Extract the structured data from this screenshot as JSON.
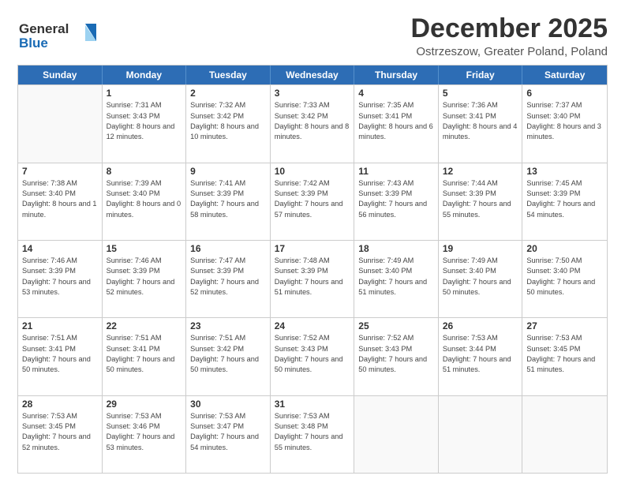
{
  "logo": {
    "line1": "General",
    "line2": "Blue"
  },
  "title": "December 2025",
  "subtitle": "Ostrzeszow, Greater Poland, Poland",
  "weekdays": [
    "Sunday",
    "Monday",
    "Tuesday",
    "Wednesday",
    "Thursday",
    "Friday",
    "Saturday"
  ],
  "weeks": [
    [
      {
        "day": "",
        "sunrise": "",
        "sunset": "",
        "daylight": ""
      },
      {
        "day": "1",
        "sunrise": "Sunrise: 7:31 AM",
        "sunset": "Sunset: 3:43 PM",
        "daylight": "Daylight: 8 hours and 12 minutes."
      },
      {
        "day": "2",
        "sunrise": "Sunrise: 7:32 AM",
        "sunset": "Sunset: 3:42 PM",
        "daylight": "Daylight: 8 hours and 10 minutes."
      },
      {
        "day": "3",
        "sunrise": "Sunrise: 7:33 AM",
        "sunset": "Sunset: 3:42 PM",
        "daylight": "Daylight: 8 hours and 8 minutes."
      },
      {
        "day": "4",
        "sunrise": "Sunrise: 7:35 AM",
        "sunset": "Sunset: 3:41 PM",
        "daylight": "Daylight: 8 hours and 6 minutes."
      },
      {
        "day": "5",
        "sunrise": "Sunrise: 7:36 AM",
        "sunset": "Sunset: 3:41 PM",
        "daylight": "Daylight: 8 hours and 4 minutes."
      },
      {
        "day": "6",
        "sunrise": "Sunrise: 7:37 AM",
        "sunset": "Sunset: 3:40 PM",
        "daylight": "Daylight: 8 hours and 3 minutes."
      }
    ],
    [
      {
        "day": "7",
        "sunrise": "Sunrise: 7:38 AM",
        "sunset": "Sunset: 3:40 PM",
        "daylight": "Daylight: 8 hours and 1 minute."
      },
      {
        "day": "8",
        "sunrise": "Sunrise: 7:39 AM",
        "sunset": "Sunset: 3:40 PM",
        "daylight": "Daylight: 8 hours and 0 minutes."
      },
      {
        "day": "9",
        "sunrise": "Sunrise: 7:41 AM",
        "sunset": "Sunset: 3:39 PM",
        "daylight": "Daylight: 7 hours and 58 minutes."
      },
      {
        "day": "10",
        "sunrise": "Sunrise: 7:42 AM",
        "sunset": "Sunset: 3:39 PM",
        "daylight": "Daylight: 7 hours and 57 minutes."
      },
      {
        "day": "11",
        "sunrise": "Sunrise: 7:43 AM",
        "sunset": "Sunset: 3:39 PM",
        "daylight": "Daylight: 7 hours and 56 minutes."
      },
      {
        "day": "12",
        "sunrise": "Sunrise: 7:44 AM",
        "sunset": "Sunset: 3:39 PM",
        "daylight": "Daylight: 7 hours and 55 minutes."
      },
      {
        "day": "13",
        "sunrise": "Sunrise: 7:45 AM",
        "sunset": "Sunset: 3:39 PM",
        "daylight": "Daylight: 7 hours and 54 minutes."
      }
    ],
    [
      {
        "day": "14",
        "sunrise": "Sunrise: 7:46 AM",
        "sunset": "Sunset: 3:39 PM",
        "daylight": "Daylight: 7 hours and 53 minutes."
      },
      {
        "day": "15",
        "sunrise": "Sunrise: 7:46 AM",
        "sunset": "Sunset: 3:39 PM",
        "daylight": "Daylight: 7 hours and 52 minutes."
      },
      {
        "day": "16",
        "sunrise": "Sunrise: 7:47 AM",
        "sunset": "Sunset: 3:39 PM",
        "daylight": "Daylight: 7 hours and 52 minutes."
      },
      {
        "day": "17",
        "sunrise": "Sunrise: 7:48 AM",
        "sunset": "Sunset: 3:39 PM",
        "daylight": "Daylight: 7 hours and 51 minutes."
      },
      {
        "day": "18",
        "sunrise": "Sunrise: 7:49 AM",
        "sunset": "Sunset: 3:40 PM",
        "daylight": "Daylight: 7 hours and 51 minutes."
      },
      {
        "day": "19",
        "sunrise": "Sunrise: 7:49 AM",
        "sunset": "Sunset: 3:40 PM",
        "daylight": "Daylight: 7 hours and 50 minutes."
      },
      {
        "day": "20",
        "sunrise": "Sunrise: 7:50 AM",
        "sunset": "Sunset: 3:40 PM",
        "daylight": "Daylight: 7 hours and 50 minutes."
      }
    ],
    [
      {
        "day": "21",
        "sunrise": "Sunrise: 7:51 AM",
        "sunset": "Sunset: 3:41 PM",
        "daylight": "Daylight: 7 hours and 50 minutes."
      },
      {
        "day": "22",
        "sunrise": "Sunrise: 7:51 AM",
        "sunset": "Sunset: 3:41 PM",
        "daylight": "Daylight: 7 hours and 50 minutes."
      },
      {
        "day": "23",
        "sunrise": "Sunrise: 7:51 AM",
        "sunset": "Sunset: 3:42 PM",
        "daylight": "Daylight: 7 hours and 50 minutes."
      },
      {
        "day": "24",
        "sunrise": "Sunrise: 7:52 AM",
        "sunset": "Sunset: 3:43 PM",
        "daylight": "Daylight: 7 hours and 50 minutes."
      },
      {
        "day": "25",
        "sunrise": "Sunrise: 7:52 AM",
        "sunset": "Sunset: 3:43 PM",
        "daylight": "Daylight: 7 hours and 50 minutes."
      },
      {
        "day": "26",
        "sunrise": "Sunrise: 7:53 AM",
        "sunset": "Sunset: 3:44 PM",
        "daylight": "Daylight: 7 hours and 51 minutes."
      },
      {
        "day": "27",
        "sunrise": "Sunrise: 7:53 AM",
        "sunset": "Sunset: 3:45 PM",
        "daylight": "Daylight: 7 hours and 51 minutes."
      }
    ],
    [
      {
        "day": "28",
        "sunrise": "Sunrise: 7:53 AM",
        "sunset": "Sunset: 3:45 PM",
        "daylight": "Daylight: 7 hours and 52 minutes."
      },
      {
        "day": "29",
        "sunrise": "Sunrise: 7:53 AM",
        "sunset": "Sunset: 3:46 PM",
        "daylight": "Daylight: 7 hours and 53 minutes."
      },
      {
        "day": "30",
        "sunrise": "Sunrise: 7:53 AM",
        "sunset": "Sunset: 3:47 PM",
        "daylight": "Daylight: 7 hours and 54 minutes."
      },
      {
        "day": "31",
        "sunrise": "Sunrise: 7:53 AM",
        "sunset": "Sunset: 3:48 PM",
        "daylight": "Daylight: 7 hours and 55 minutes."
      },
      {
        "day": "",
        "sunrise": "",
        "sunset": "",
        "daylight": ""
      },
      {
        "day": "",
        "sunrise": "",
        "sunset": "",
        "daylight": ""
      },
      {
        "day": "",
        "sunrise": "",
        "sunset": "",
        "daylight": ""
      }
    ]
  ]
}
